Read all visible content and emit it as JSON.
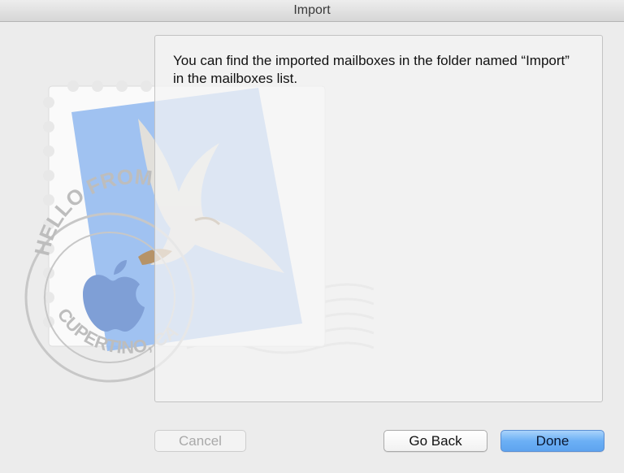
{
  "window": {
    "title": "Import"
  },
  "illustration": {
    "stamp_text_top": "HELLO FROM",
    "stamp_text_bottom": "CUPERTINO, CA"
  },
  "message": {
    "text": "You can find the imported mailboxes in the folder named “Import” in the mailboxes list."
  },
  "buttons": {
    "cancel": "Cancel",
    "go_back": "Go Back",
    "done": "Done"
  },
  "colors": {
    "stamp_blue": "#8fb7ef",
    "postmark_gray": "#c9c9c9",
    "primary_button": "#6cb0f5"
  }
}
